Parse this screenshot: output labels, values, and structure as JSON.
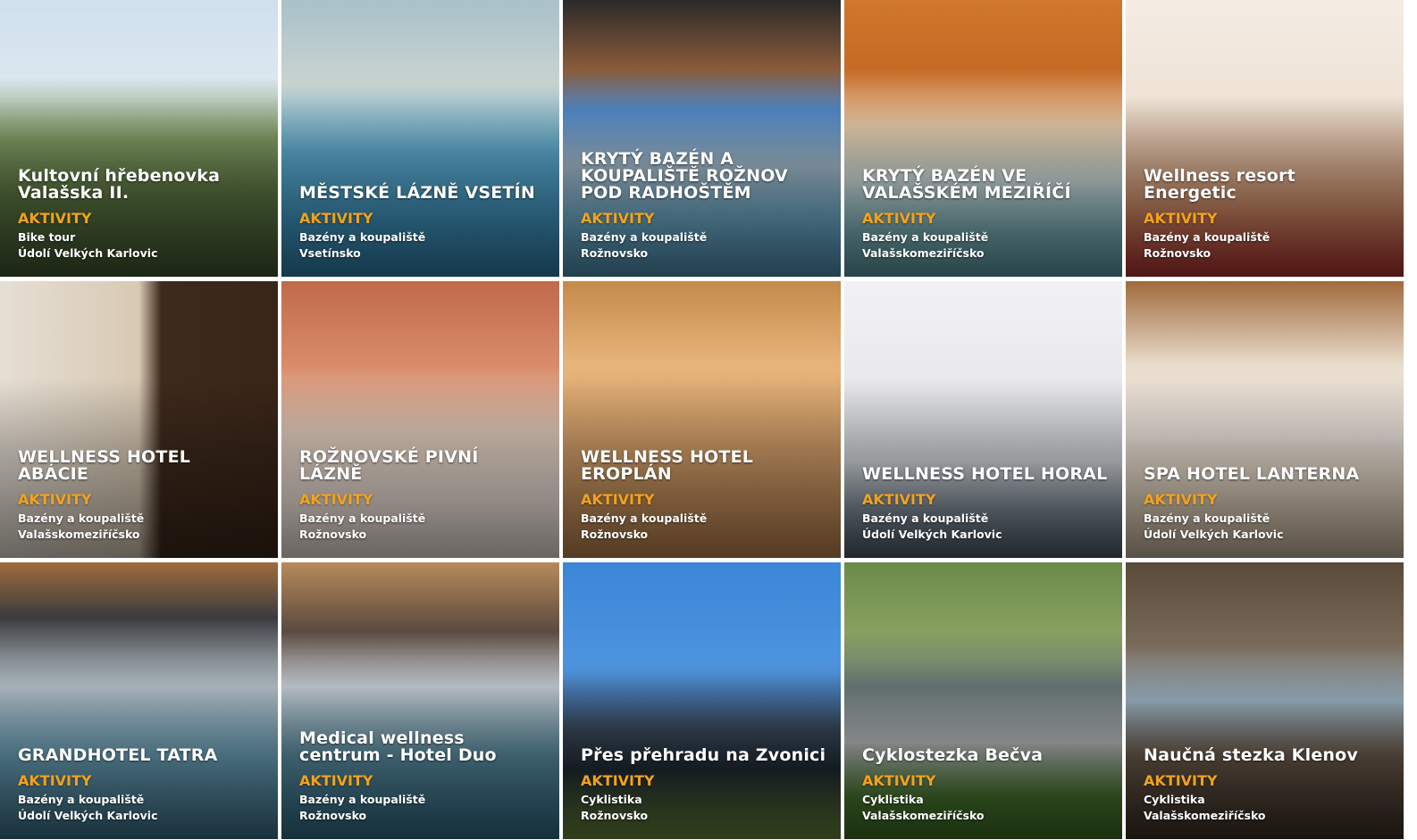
{
  "tiles": [
    {
      "title": "Kultovní hřebenovka Valašska II.",
      "category": "AKTIVITY",
      "type": "Bike tour",
      "region": "Údolí Velkých Karlovic"
    },
    {
      "title": "MĚSTSKÉ LÁZNĚ VSETÍN",
      "category": "AKTIVITY",
      "type": "Bazény a koupaliště",
      "region": "Vsetínsko"
    },
    {
      "title": "KRYTÝ BAZÉN A KOUPALIŠTĚ ROŽNOV POD RADHOŠTĚM",
      "category": "AKTIVITY",
      "type": "Bazény a koupaliště",
      "region": "Rožnovsko"
    },
    {
      "title": "KRYTÝ BAZÉN VE VALAŠSKÉM MEZIŘÍČÍ",
      "category": "AKTIVITY",
      "type": "Bazény a koupaliště",
      "region": "Valašskomeziříčsko"
    },
    {
      "title": "Wellness resort Energetic",
      "category": "AKTIVITY",
      "type": "Bazény a koupaliště",
      "region": "Rožnovsko"
    },
    {
      "title": "WELLNESS HOTEL ABÁCIE",
      "category": "AKTIVITY",
      "type": "Bazény a koupaliště",
      "region": "Valašskomeziříčsko"
    },
    {
      "title": "ROŽNOVSKÉ PIVNÍ LÁZNĚ",
      "category": "AKTIVITY",
      "type": "Bazény a koupaliště",
      "region": "Rožnovsko"
    },
    {
      "title": "WELLNESS HOTEL EROPLÁN",
      "category": "AKTIVITY",
      "type": "Bazény a koupaliště",
      "region": "Rožnovsko"
    },
    {
      "title": "WELLNESS HOTEL HORAL",
      "category": "AKTIVITY",
      "type": "Bazény a koupaliště",
      "region": "Údolí Velkých Karlovic"
    },
    {
      "title": "SPA HOTEL LANTERNA",
      "category": "AKTIVITY",
      "type": "Bazény a koupaliště",
      "region": "Údolí Velkých Karlovic"
    },
    {
      "title": "GRANDHOTEL TATRA",
      "category": "AKTIVITY",
      "type": "Bazény a koupaliště",
      "region": "Údolí Velkých Karlovic"
    },
    {
      "title": "Medical wellness centrum - Hotel Duo",
      "category": "AKTIVITY",
      "type": "Bazény a koupaliště",
      "region": "Rožnovsko"
    },
    {
      "title": "Přes přehradu na Zvonici",
      "category": "AKTIVITY",
      "type": "Cyklistika",
      "region": "Rožnovsko"
    },
    {
      "title": "Cyklostezka Bečva",
      "category": "AKTIVITY",
      "type": "Cyklistika",
      "region": "Valašskomeziříčsko"
    },
    {
      "title": "Naučná stezka Klenov",
      "category": "AKTIVITY",
      "type": "Cyklistika",
      "region": "Valašskomeziříčsko"
    }
  ]
}
